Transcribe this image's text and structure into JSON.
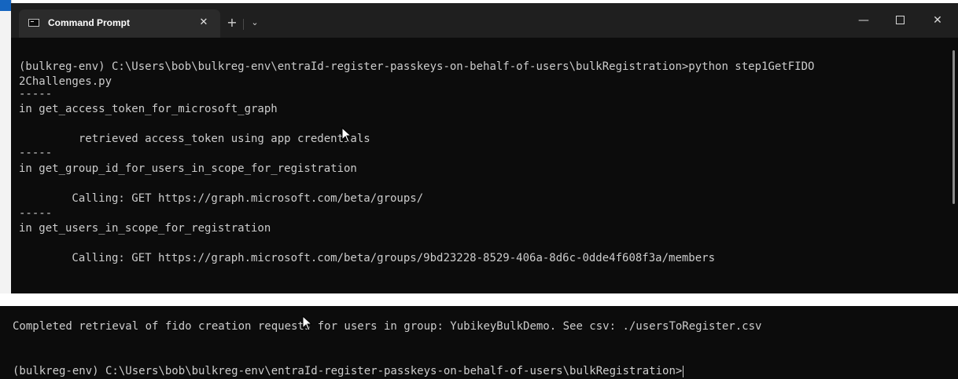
{
  "window": {
    "tab_title": "Command Prompt",
    "tab_close_glyph": "✕",
    "new_tab_glyph": "+",
    "dropdown_glyph": "⌄",
    "minimize_glyph": "—",
    "close_glyph": "✕"
  },
  "terminal": {
    "lines": [
      "(bulkreg-env) C:\\Users\\bob\\bulkreg-env\\entraId-register-passkeys-on-behalf-of-users\\bulkRegistration>python step1GetFIDO",
      "2Challenges.py",
      "-----",
      "in get_access_token_for_microsoft_graph",
      "",
      "         retrieved access_token using app credentials",
      "-----",
      "in get_group_id_for_users_in_scope_for_registration",
      "",
      "        Calling: GET https://graph.microsoft.com/beta/groups/",
      "-----",
      "in get_users_in_scope_for_registration",
      "",
      "        Calling: GET https://graph.microsoft.com/beta/groups/9bd23228-8529-406a-8d6c-0dde4f608f3a/members"
    ]
  },
  "console2": {
    "completed_line": "Completed retrieval of fido creation requests for users in group: YubikeyBulkDemo. See csv: ./usersToRegister.csv",
    "prompt_line": "(bulkreg-env) C:\\Users\\bob\\bulkreg-env\\entraId-register-passkeys-on-behalf-of-users\\bulkRegistration>"
  }
}
